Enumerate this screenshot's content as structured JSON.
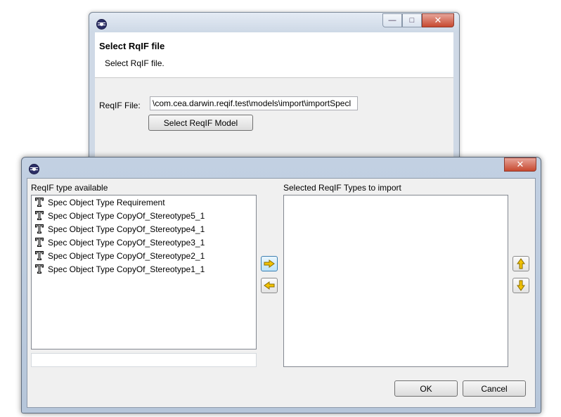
{
  "wizard": {
    "banner_title": "Select RqIF file",
    "banner_description": "Select RqIF file.",
    "reqif_file_label": "ReqIF File:",
    "reqif_file_value": "\\com.cea.darwin.reqif.test\\models\\import\\importSpecl",
    "select_model_button": "Select ReqIF Model",
    "window_controls": {
      "minimize": "minimize-icon",
      "maximize": "maximize-icon",
      "close": "close-icon"
    }
  },
  "dialog": {
    "available_label": "ReqIF type available",
    "selected_label": "Selected ReqIF Types to import",
    "available_types": [
      {
        "label": "Spec Object Type Requirement",
        "icon": "spec-object-type-icon"
      },
      {
        "label": "Spec Object Type CopyOf_Stereotype5_1",
        "icon": "spec-object-type-icon"
      },
      {
        "label": "Spec Object Type CopyOf_Stereotype4_1",
        "icon": "spec-object-type-icon"
      },
      {
        "label": "Spec Object Type CopyOf_Stereotype3_1",
        "icon": "spec-object-type-icon"
      },
      {
        "label": "Spec Object Type CopyOf_Stereotype2_1",
        "icon": "spec-object-type-icon"
      },
      {
        "label": "Spec Object Type CopyOf_Stereotype1_1",
        "icon": "spec-object-type-icon"
      }
    ],
    "selected_types": [],
    "filter_value": "",
    "ok_button": "OK",
    "cancel_button": "Cancel",
    "arrow_color": "#f2c200"
  }
}
